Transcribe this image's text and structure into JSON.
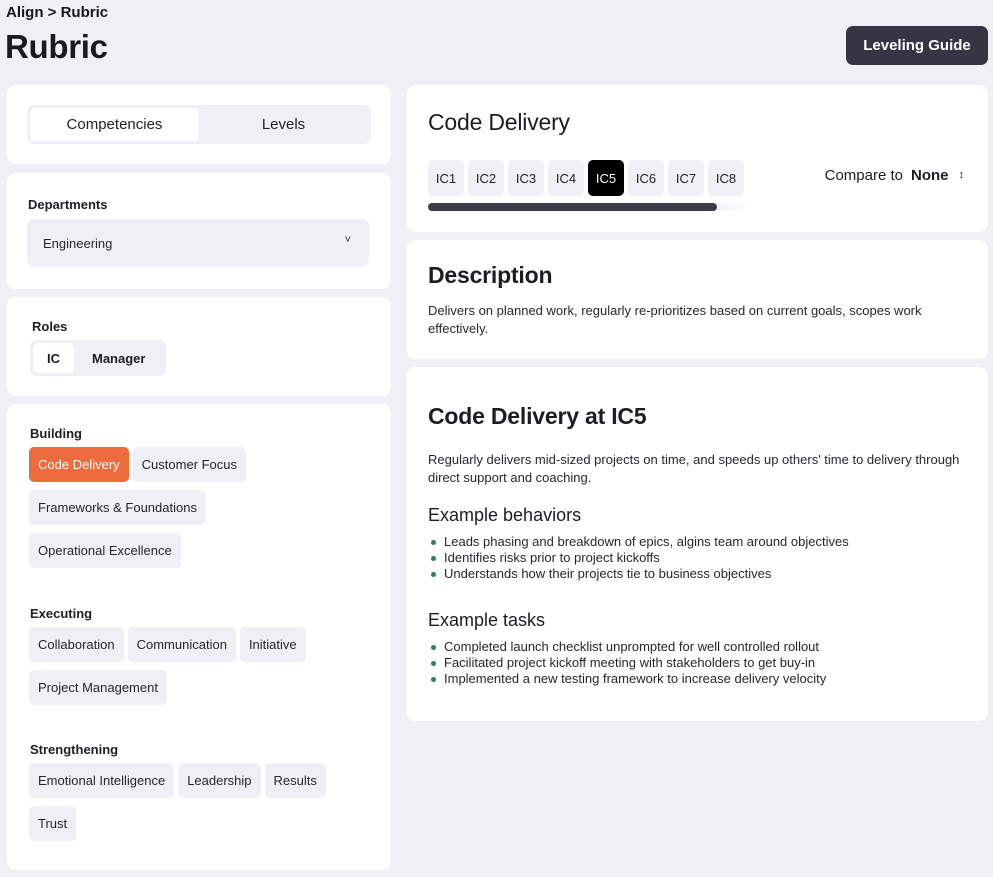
{
  "breadcrumb": "Align > Rubric",
  "page_title": "Rubric",
  "leveling_guide_label": "Leveling Guide",
  "view_tabs": [
    "Competencies",
    "Levels"
  ],
  "departments": {
    "label": "Departments",
    "selected": "Engineering"
  },
  "roles": {
    "label": "Roles",
    "options": [
      "IC",
      "Manager"
    ],
    "selected": "IC"
  },
  "groups": [
    {
      "name": "Building",
      "items": [
        "Code Delivery",
        "Customer Focus",
        "Frameworks & Foundations",
        "Operational Excellence"
      ]
    },
    {
      "name": "Executing",
      "items": [
        "Collaboration",
        "Communication",
        "Initiative",
        "Project Management"
      ]
    },
    {
      "name": "Strengthening",
      "items": [
        "Emotional Intelligence",
        "Leadership",
        "Results",
        "Trust"
      ]
    }
  ],
  "selected_competency": "Code Delivery",
  "competency_title": "Code Delivery",
  "levels": [
    "IC1",
    "IC2",
    "IC3",
    "IC4",
    "IC5",
    "IC6",
    "IC7",
    "IC8"
  ],
  "selected_level": "IC5",
  "compare": {
    "label": "Compare to",
    "value": "None"
  },
  "description": {
    "title": "Description",
    "text": "Delivers on planned work, regularly re-prioritizes based on current goals, scopes work effectively."
  },
  "detail": {
    "title": "Code Delivery at IC5",
    "summary": "Regularly delivers mid-sized projects on time, and speeds up others' time to delivery through direct support and coaching.",
    "behaviors_title": "Example behaviors",
    "behaviors": [
      "Leads phasing and breakdown of epics, algins team around objectives",
      "Identifies risks prior to project kickoffs",
      "Understands how their projects tie to business objectives"
    ],
    "tasks_title": "Example tasks",
    "tasks": [
      "Completed launch checklist unprompted for well controlled rollout",
      "Facilitated project kickoff meeting with stakeholders to get buy-in",
      "Implemented a new testing framework to increase delivery velocity"
    ]
  }
}
